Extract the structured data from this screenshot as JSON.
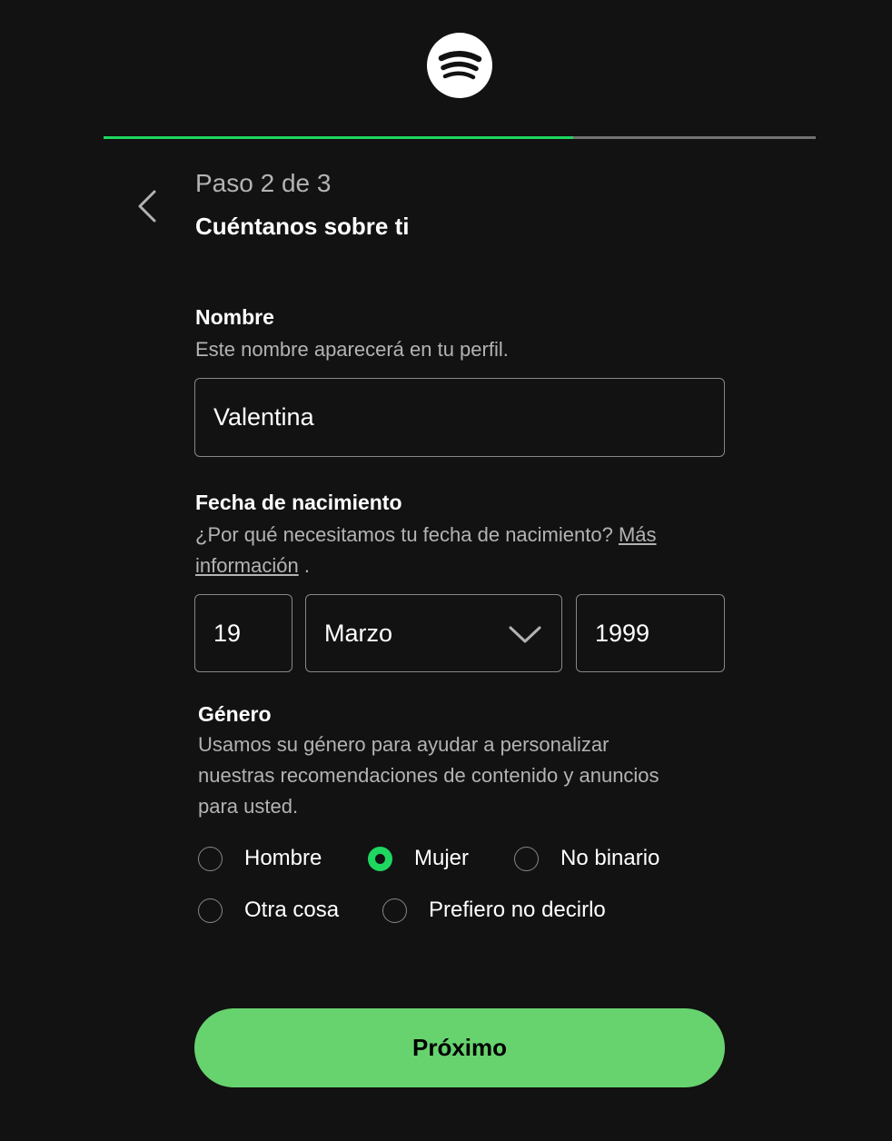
{
  "brand": {
    "logo_icon": "spotify-logo-icon",
    "accent_color": "#1ed760",
    "button_color": "#66d36e"
  },
  "progress": {
    "fraction": 0.66
  },
  "header": {
    "back_icon": "chevron-left-icon",
    "step": "Paso 2 de 3",
    "title": "Cuéntanos sobre ti"
  },
  "name_field": {
    "label": "Nombre",
    "help": "Este nombre aparecerá en tu perfil.",
    "value": "Valentina"
  },
  "birthdate": {
    "label": "Fecha de nacimiento",
    "help": "¿Por qué necesitamos tu fecha de nacimiento?",
    "link_part1": "Más",
    "link_part2": "información",
    "link_suffix": ".",
    "day": "19",
    "month": "Marzo",
    "year": "1999"
  },
  "gender": {
    "label": "Género",
    "help": "Usamos su género para ayudar a personalizar nuestras recomendaciones de contenido y anuncios para usted.",
    "options": [
      {
        "label": "Hombre",
        "selected": false
      },
      {
        "label": "Mujer",
        "selected": true
      },
      {
        "label": "No binario",
        "selected": false
      },
      {
        "label": "Otra cosa",
        "selected": false
      },
      {
        "label": "Prefiero no decirlo",
        "selected": false
      }
    ]
  },
  "actions": {
    "next_label": "Próximo"
  }
}
